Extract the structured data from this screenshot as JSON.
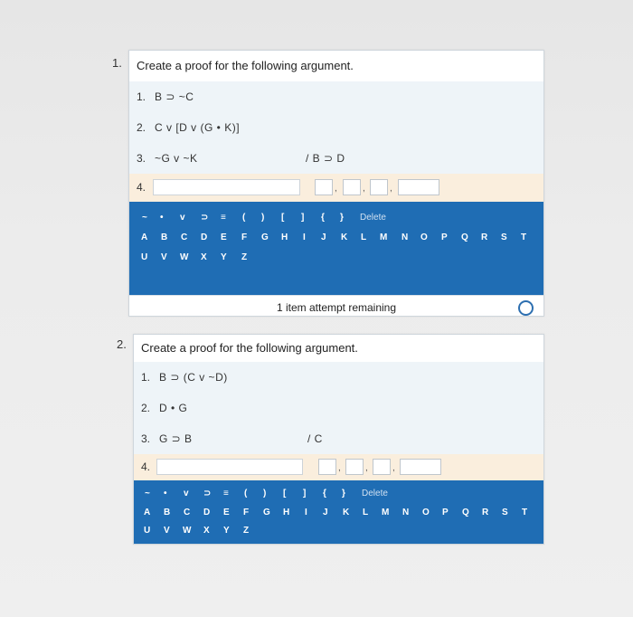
{
  "q1": {
    "number": "1.",
    "title": "Create a proof for the following argument.",
    "premises": [
      {
        "num": "1.",
        "text": "B ⊃ ~C"
      },
      {
        "num": "2.",
        "text": "C v [D v (G • K)]"
      },
      {
        "num": "3.",
        "text": "~G v ~K"
      }
    ],
    "conclusion": "/ B ⊃ D",
    "input_row_num": "4.",
    "keyboard_symbols": [
      "~",
      "•",
      "v",
      "⊃",
      "≡",
      "(",
      ")",
      "[",
      "]",
      "{",
      "}"
    ],
    "delete_label": "Delete",
    "letters_row1": [
      "A",
      "B",
      "C",
      "D",
      "E",
      "F",
      "G",
      "H",
      "I",
      "J",
      "K",
      "L",
      "M",
      "N",
      "O",
      "P",
      "Q",
      "R",
      "S",
      "T"
    ],
    "letters_row2": [
      "U",
      "V",
      "W",
      "X",
      "Y",
      "Z"
    ],
    "attempts_text": "1 item attempt remaining"
  },
  "q2": {
    "number": "2.",
    "title": "Create a proof for the following argument.",
    "premises": [
      {
        "num": "1.",
        "text": "B ⊃ (C v ~D)"
      },
      {
        "num": "2.",
        "text": "D • G"
      },
      {
        "num": "3.",
        "text": "G ⊃ B"
      }
    ],
    "conclusion": "/ C",
    "input_row_num": "4.",
    "keyboard_symbols": [
      "~",
      "•",
      "v",
      "⊃",
      "≡",
      "(",
      ")",
      "[",
      "]",
      "{",
      "}"
    ],
    "delete_label": "Delete",
    "letters_row1": [
      "A",
      "B",
      "C",
      "D",
      "E",
      "F",
      "G",
      "H",
      "I",
      "J",
      "K",
      "L",
      "M",
      "N",
      "O",
      "P",
      "Q",
      "R",
      "S",
      "T"
    ],
    "letters_row2": [
      "U",
      "V",
      "W",
      "X",
      "Y",
      "Z"
    ]
  },
  "justification_separators": [
    ",",
    ",",
    ","
  ],
  "colors": {
    "keyboard_blue": "#1f6db4",
    "premise_bg": "#eef4f8",
    "input_row_bg": "#faeedd",
    "radio_blue": "#2d6fb0"
  },
  "icons": {
    "attempt_radio": "radio-circle-icon"
  }
}
